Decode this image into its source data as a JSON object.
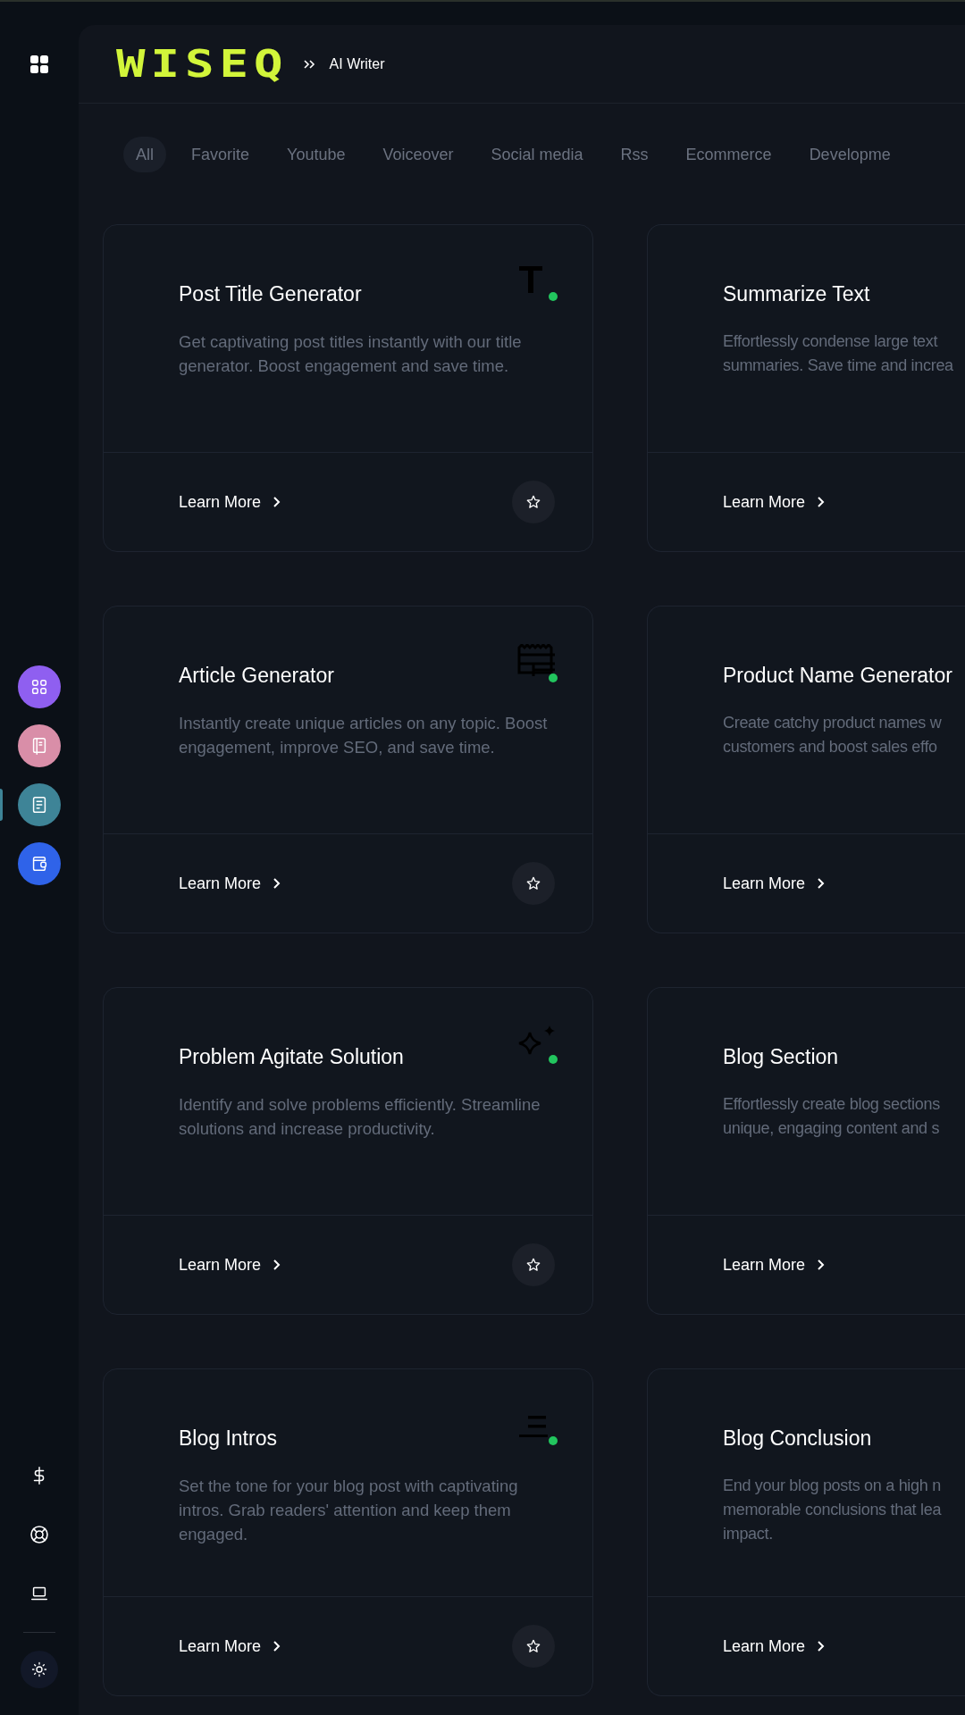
{
  "sidebar": {
    "nav": [
      {
        "kind": "apps",
        "color": "#8f5ff0",
        "selected": false
      },
      {
        "kind": "notebook",
        "color": "#d98ea8",
        "selected": false
      },
      {
        "kind": "document",
        "color": "#3e8497",
        "selected": true
      },
      {
        "kind": "wallet",
        "color": "#2f63e9",
        "selected": false
      }
    ],
    "bottom": [
      {
        "kind": "dollar"
      },
      {
        "kind": "lifebuoy"
      },
      {
        "kind": "laptop"
      }
    ]
  },
  "header": {
    "logo": "WISEQ",
    "breadcrumb": "AI Writer"
  },
  "tabs": [
    {
      "label": "All",
      "selected": true
    },
    {
      "label": "Favorite",
      "selected": false
    },
    {
      "label": "Youtube",
      "selected": false
    },
    {
      "label": "Voiceover",
      "selected": false
    },
    {
      "label": "Social media",
      "selected": false
    },
    {
      "label": "Rss",
      "selected": false
    },
    {
      "label": "Ecommerce",
      "selected": false
    },
    {
      "label": "Developme",
      "selected": false
    }
  ],
  "cards": [
    {
      "kind": "full",
      "title": "Post Title Generator",
      "description": "Get captivating post titles instantly with our title generator. Boost engagement and save time.",
      "link": "Learn More",
      "favorite": false
    },
    {
      "kind": "cut",
      "title": "Summarize Text",
      "lines": [
        "Effortlessly condense large text",
        "summaries. Save time and increa"
      ],
      "link": "Learn More"
    },
    {
      "kind": "full",
      "title": "Article Generator",
      "description": "Instantly create unique articles on any topic. Boost engagement, improve SEO, and save time.",
      "link": "Learn More",
      "favorite": false
    },
    {
      "kind": "cut",
      "title": "Product Name Generator",
      "lines": [
        "Create catchy product names w",
        "customers and boost sales effo"
      ],
      "link": "Learn More"
    },
    {
      "kind": "full",
      "title": "Problem Agitate Solution",
      "description": "Identify and solve problems efficiently. Streamline solutions and increase productivity.",
      "link": "Learn More",
      "favorite": false
    },
    {
      "kind": "cut",
      "title": "Blog Section",
      "lines": [
        "Effortlessly create blog sections",
        "unique, engaging content and s"
      ],
      "link": "Learn More"
    },
    {
      "kind": "full",
      "title": "Blog Intros",
      "description": "Set the tone for your blog post with captivating intros. Grab readers' attention and keep them engaged.",
      "link": "Learn More",
      "favorite": false
    },
    {
      "kind": "cut",
      "title": "Blog Conclusion",
      "lines": [
        "End your blog posts on a high n",
        "memorable conclusions that lea",
        "impact."
      ],
      "link": "Learn More"
    }
  ]
}
